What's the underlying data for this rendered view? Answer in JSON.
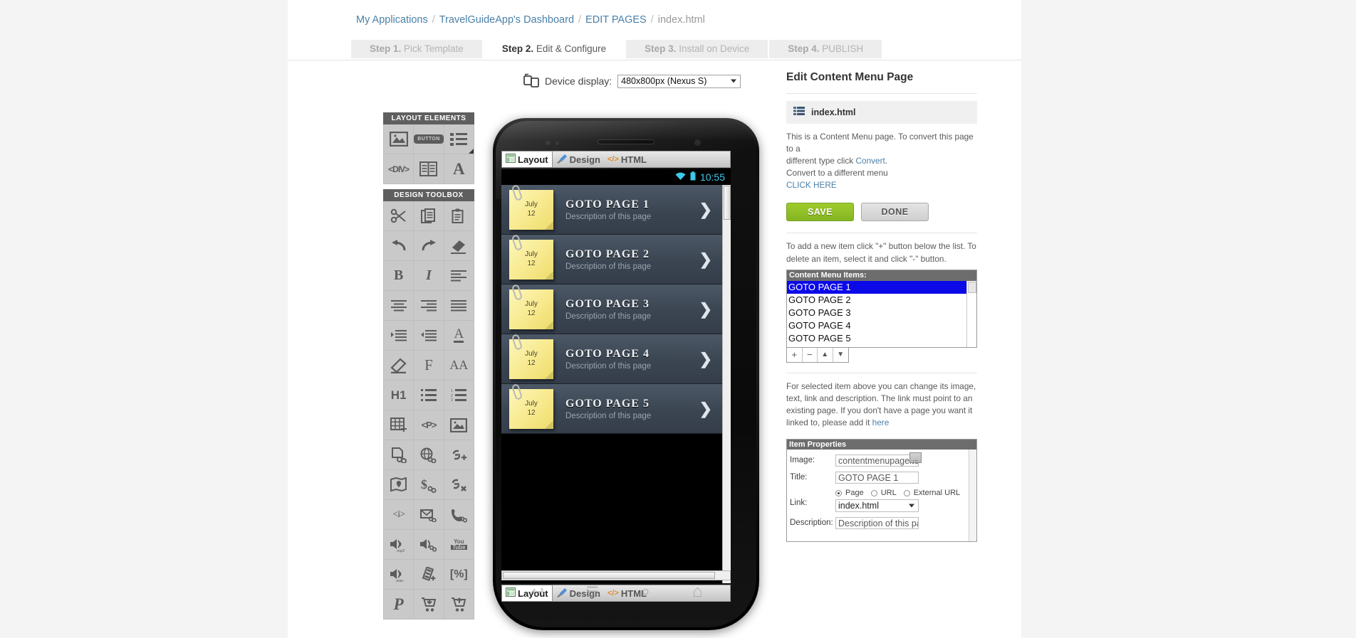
{
  "breadcrumb": {
    "items": [
      "My Applications",
      "TravelGuideApp's Dashboard",
      "EDIT PAGES",
      "index.html"
    ],
    "separator": "/"
  },
  "steps": [
    {
      "num": "Step 1.",
      "label": "Pick Template",
      "active": false
    },
    {
      "num": "Step 2.",
      "label": "Edit & Configure",
      "active": true
    },
    {
      "num": "Step 3.",
      "label": "Install on Device",
      "active": false
    },
    {
      "num": "Step 4.",
      "label": "PUBLISH",
      "active": false
    }
  ],
  "device": {
    "icon": "device-rotate-icon",
    "label": "Device display:",
    "selected": "480x800px (Nexus S)"
  },
  "layout_elements": {
    "title": "LAYOUT ELEMENTS",
    "items": [
      {
        "name": "image-element-icon"
      },
      {
        "name": "button-element-icon",
        "label": "BUTTON"
      },
      {
        "name": "list-element-icon"
      },
      {
        "name": "div-element-icon",
        "label": "<DIV>"
      },
      {
        "name": "columns-element-icon"
      },
      {
        "name": "text-element-icon",
        "label": "A"
      }
    ]
  },
  "design_toolbox": {
    "title": "DESIGN TOOLBOX",
    "items": [
      {
        "name": "cut-icon"
      },
      {
        "name": "copy-icon"
      },
      {
        "name": "paste-icon"
      },
      {
        "name": "undo-icon"
      },
      {
        "name": "redo-icon"
      },
      {
        "name": "eraser-icon"
      },
      {
        "name": "bold-icon",
        "label": "B"
      },
      {
        "name": "italic-icon",
        "label": "I"
      },
      {
        "name": "align-left-icon"
      },
      {
        "name": "align-center-icon"
      },
      {
        "name": "align-right-icon"
      },
      {
        "name": "align-justify-icon"
      },
      {
        "name": "indent-increase-icon"
      },
      {
        "name": "indent-decrease-icon"
      },
      {
        "name": "font-color-icon",
        "label": "A"
      },
      {
        "name": "highlighter-icon"
      },
      {
        "name": "font-family-icon",
        "label": "F"
      },
      {
        "name": "font-size-icon",
        "label": "AA"
      },
      {
        "name": "heading-one-icon",
        "label": "H1"
      },
      {
        "name": "bullet-list-icon"
      },
      {
        "name": "numbered-list-icon"
      },
      {
        "name": "insert-table-icon"
      },
      {
        "name": "paragraph-icon",
        "label": "<P>"
      },
      {
        "name": "insert-image-icon"
      },
      {
        "name": "page-link-icon"
      },
      {
        "name": "web-link-icon"
      },
      {
        "name": "add-link-icon"
      },
      {
        "name": "map-link-icon"
      },
      {
        "name": "payment-link-icon"
      },
      {
        "name": "remove-link-icon"
      },
      {
        "name": "info-icon",
        "label": "<i>"
      },
      {
        "name": "email-link-icon"
      },
      {
        "name": "phone-link-icon"
      },
      {
        "name": "mp3-audio-icon",
        "label": ".mp3"
      },
      {
        "name": "audio-link-icon"
      },
      {
        "name": "youtube-icon",
        "label": "You Tube"
      },
      {
        "name": "wav-audio-icon",
        "label": ".wav"
      },
      {
        "name": "video-icon"
      },
      {
        "name": "percent-icon",
        "label": "[%]"
      },
      {
        "name": "paypal-icon",
        "label": "P"
      },
      {
        "name": "add-to-cart-icon"
      },
      {
        "name": "remove-from-cart-icon"
      }
    ]
  },
  "phone": {
    "mode_tabs": [
      {
        "name": "layout-tab",
        "label": "Layout",
        "icon": "layout-icon",
        "selected": true
      },
      {
        "name": "design-tab",
        "label": "Design",
        "icon": "brush-icon",
        "selected": false
      },
      {
        "name": "html-tab",
        "label": "HTML",
        "icon": "code-icon",
        "selected": false
      }
    ],
    "status_bar": {
      "wifi_icon": "wifi-icon",
      "battery_icon": "battery-icon",
      "time": "10:55"
    },
    "menu_rows": [
      {
        "note_month": "July",
        "note_day": "12",
        "title": "GOTO PAGE 1",
        "desc": "Description of this page"
      },
      {
        "note_month": "July",
        "note_day": "12",
        "title": "GOTO PAGE 2",
        "desc": "Description of this page"
      },
      {
        "note_month": "July",
        "note_day": "12",
        "title": "GOTO PAGE 3",
        "desc": "Description of this page"
      },
      {
        "note_month": "July",
        "note_day": "12",
        "title": "GOTO PAGE 4",
        "desc": "Description of this page"
      },
      {
        "note_month": "July",
        "note_day": "12",
        "title": "GOTO PAGE 5",
        "desc": "Description of this page"
      }
    ],
    "nav_keys": [
      {
        "name": "back-key-icon",
        "glyph": "↩"
      },
      {
        "name": "menu-key-icon",
        "glyph": "☰"
      },
      {
        "name": "search-key-icon",
        "glyph": "⌕"
      },
      {
        "name": "home-key-icon",
        "glyph": "⌂"
      }
    ]
  },
  "editor": {
    "title": "Edit Content Menu Page",
    "file_name": "index.html",
    "file_icon": "content-menu-page-icon",
    "description_line1": "This is a Content Menu page. To convert this page to a",
    "description_line2_pre": "different type click ",
    "convert_link": "Convert",
    "description_line2_post": ".",
    "description_line3": "Convert to a different menu",
    "click_here_link": "CLICK HERE",
    "save_label": "SAVE",
    "done_label": "DONE",
    "save_color": "#90c127",
    "list_help": "To add a new item click \"+\" button below the list. To delete an item, select it and click \"-\" button.",
    "list_header": "Content Menu Items:",
    "list_items": [
      {
        "label": "GOTO PAGE 1",
        "selected": true
      },
      {
        "label": "GOTO PAGE 2",
        "selected": false
      },
      {
        "label": "GOTO PAGE 3",
        "selected": false
      },
      {
        "label": "GOTO PAGE 4",
        "selected": false
      },
      {
        "label": "GOTO PAGE 5",
        "selected": false
      }
    ],
    "selection_color": "#0b09e8",
    "list_controls": [
      {
        "name": "add-item-button",
        "glyph": "+"
      },
      {
        "name": "remove-item-button",
        "glyph": "−"
      },
      {
        "name": "move-up-button",
        "glyph": "▲"
      },
      {
        "name": "move-down-button",
        "glyph": "▼"
      }
    ],
    "item_help_pre": "For selected item above you can change its image, text, link and description. The link must point to an existing page. If you don't have a page you want it linked to, please add it ",
    "item_help_link": "here",
    "properties": {
      "header": "Item Properties",
      "image_label": "Image:",
      "image_value": "contentmenupageitem",
      "browse_label": "...",
      "title_label": "Title:",
      "title_value": "GOTO PAGE 1",
      "link_label": "Link:",
      "link_options": [
        {
          "label": "Page",
          "checked": true
        },
        {
          "label": "URL",
          "checked": false
        },
        {
          "label": "External URL",
          "checked": false
        }
      ],
      "link_page_value": "index.html",
      "description_label": "Description:",
      "description_value": "Description of this page"
    }
  }
}
